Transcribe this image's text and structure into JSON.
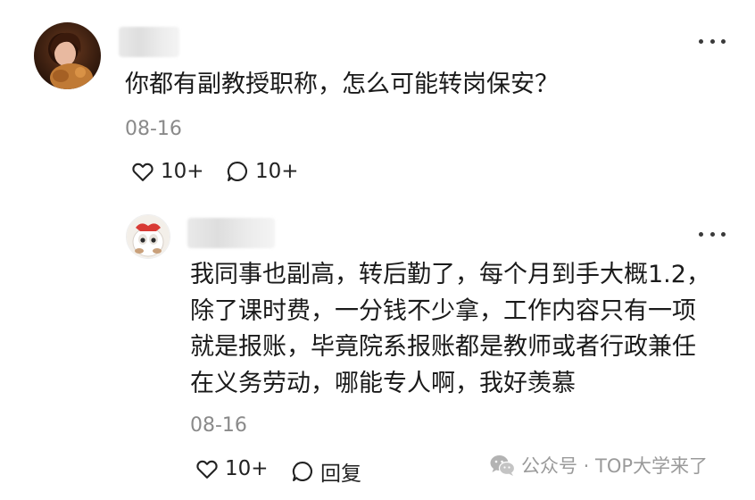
{
  "comment": {
    "text": "你都有副教授职称，怎么可能转岗保安？",
    "date": "08-16",
    "likes": "10+",
    "replies": "10+",
    "avatar_icon": "user-photo-avatar",
    "more_icon": "more-options-icon"
  },
  "reply": {
    "lines": [
      "我同事也副高，转后勤了，每个月到手大概1.2，",
      "除了课时费，一分钱不少拿，工作内容只有一项",
      "就是报账，毕竟院系报账都是教师或者行政兼任",
      "在义务劳动，哪能专人啊，我好羡慕"
    ],
    "date": "08-16",
    "likes": "10+",
    "reply_label": "回复",
    "avatar_icon": "cartoon-avatar",
    "more_icon": "more-options-icon"
  },
  "watermark": {
    "text": "公众号 · TOP大学来了",
    "icon": "wechat-icon"
  }
}
